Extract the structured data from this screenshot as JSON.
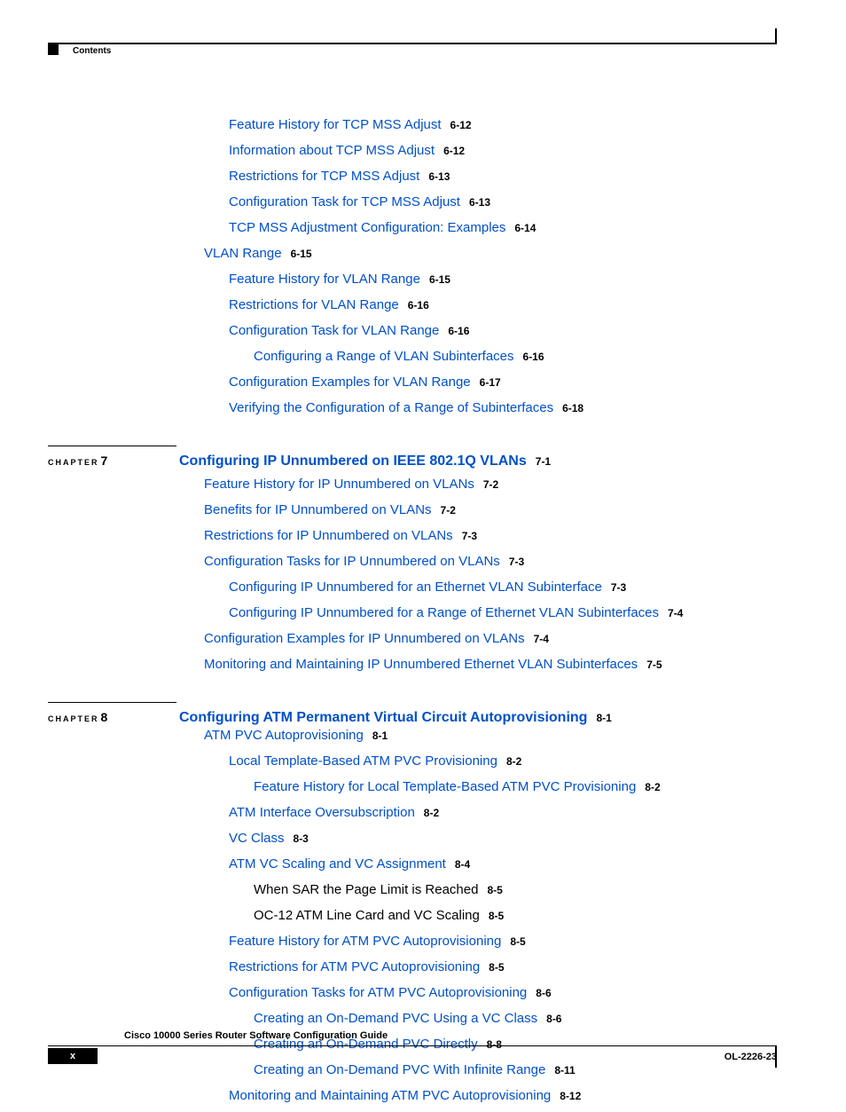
{
  "header": {
    "contents": "Contents"
  },
  "pre_entries": [
    {
      "indent": 2,
      "text": "Feature History for TCP MSS Adjust",
      "page": "6-12",
      "link": true
    },
    {
      "indent": 2,
      "text": "Information about TCP MSS Adjust",
      "page": "6-12",
      "link": true
    },
    {
      "indent": 2,
      "text": "Restrictions for TCP MSS Adjust",
      "page": "6-13",
      "link": true
    },
    {
      "indent": 2,
      "text": "Configuration Task for TCP MSS Adjust",
      "page": "6-13",
      "link": true
    },
    {
      "indent": 2,
      "text": "TCP MSS Adjustment Configuration: Examples",
      "page": "6-14",
      "link": true
    },
    {
      "indent": 1,
      "text": "VLAN Range",
      "page": "6-15",
      "link": true
    },
    {
      "indent": 2,
      "text": "Feature History for VLAN Range",
      "page": "6-15",
      "link": true
    },
    {
      "indent": 2,
      "text": "Restrictions for VLAN Range",
      "page": "6-16",
      "link": true
    },
    {
      "indent": 2,
      "text": "Configuration Task for VLAN Range",
      "page": "6-16",
      "link": true
    },
    {
      "indent": 3,
      "text": "Configuring a Range of VLAN Subinterfaces",
      "page": "6-16",
      "link": true
    },
    {
      "indent": 2,
      "text": "Configuration Examples for VLAN Range",
      "page": "6-17",
      "link": true
    },
    {
      "indent": 2,
      "text": "Verifying the Configuration of a Range of Subinterfaces",
      "page": "6-18",
      "link": true
    }
  ],
  "chapter7": {
    "label": "CHAPTER",
    "num": "7",
    "title": "Configuring IP Unnumbered on IEEE 802.1Q VLANs",
    "page": "7-1",
    "entries": [
      {
        "indent": 1,
        "text": "Feature History for IP Unnumbered on VLANs",
        "page": "7-2",
        "link": true
      },
      {
        "indent": 1,
        "text": "Benefits for IP Unnumbered on VLANs",
        "page": "7-2",
        "link": true
      },
      {
        "indent": 1,
        "text": "Restrictions for IP Unnumbered on VLANs",
        "page": "7-3",
        "link": true
      },
      {
        "indent": 1,
        "text": "Configuration Tasks for IP Unnumbered on VLANs",
        "page": "7-3",
        "link": true
      },
      {
        "indent": 2,
        "text": "Configuring IP Unnumbered for an Ethernet VLAN Subinterface",
        "page": "7-3",
        "link": true
      },
      {
        "indent": 2,
        "text": "Configuring IP Unnumbered for a Range of Ethernet VLAN Subinterfaces",
        "page": "7-4",
        "link": true
      },
      {
        "indent": 1,
        "text": "Configuration Examples for IP Unnumbered on VLANs",
        "page": "7-4",
        "link": true
      },
      {
        "indent": 1,
        "text": "Monitoring and Maintaining IP Unnumbered Ethernet VLAN Subinterfaces",
        "page": "7-5",
        "link": true
      }
    ]
  },
  "chapter8": {
    "label": "CHAPTER",
    "num": "8",
    "title": "Configuring ATM Permanent Virtual Circuit Autoprovisioning",
    "page": "8-1",
    "entries": [
      {
        "indent": 1,
        "text": "ATM PVC Autoprovisioning",
        "page": "8-1",
        "link": true
      },
      {
        "indent": 2,
        "text": "Local Template-Based ATM PVC Provisioning",
        "page": "8-2",
        "link": true
      },
      {
        "indent": 3,
        "text": "Feature History for Local Template-Based ATM PVC Provisioning",
        "page": "8-2",
        "link": true
      },
      {
        "indent": 2,
        "text": "ATM Interface Oversubscription",
        "page": "8-2",
        "link": true
      },
      {
        "indent": 2,
        "text": "VC Class",
        "page": "8-3",
        "link": true
      },
      {
        "indent": 2,
        "text": "ATM VC Scaling and VC Assignment",
        "page": "8-4",
        "link": true
      },
      {
        "indent": 3,
        "text": "When SAR the Page Limit is Reached",
        "page": "8-5",
        "link": false
      },
      {
        "indent": 3,
        "text": "OC-12 ATM Line Card and VC Scaling",
        "page": "8-5",
        "link": false
      },
      {
        "indent": 2,
        "text": "Feature History for ATM PVC Autoprovisioning",
        "page": "8-5",
        "link": true
      },
      {
        "indent": 2,
        "text": "Restrictions for ATM PVC Autoprovisioning",
        "page": "8-5",
        "link": true
      },
      {
        "indent": 2,
        "text": "Configuration Tasks for ATM PVC Autoprovisioning",
        "page": "8-6",
        "link": true
      },
      {
        "indent": 3,
        "text": "Creating an On-Demand PVC Using a VC Class",
        "page": "8-6",
        "link": true
      },
      {
        "indent": 3,
        "text": "Creating an On-Demand PVC Directly",
        "page": "8-8",
        "link": true
      },
      {
        "indent": 3,
        "text": "Creating an On-Demand PVC With Infinite Range",
        "page": "8-11",
        "link": true
      },
      {
        "indent": 2,
        "text": "Monitoring and Maintaining ATM PVC Autoprovisioning",
        "page": "8-12",
        "link": true
      }
    ]
  },
  "footer": {
    "title": "Cisco 10000 Series Router Software Configuration Guide",
    "page": "x",
    "docid": "OL-2226-23"
  }
}
